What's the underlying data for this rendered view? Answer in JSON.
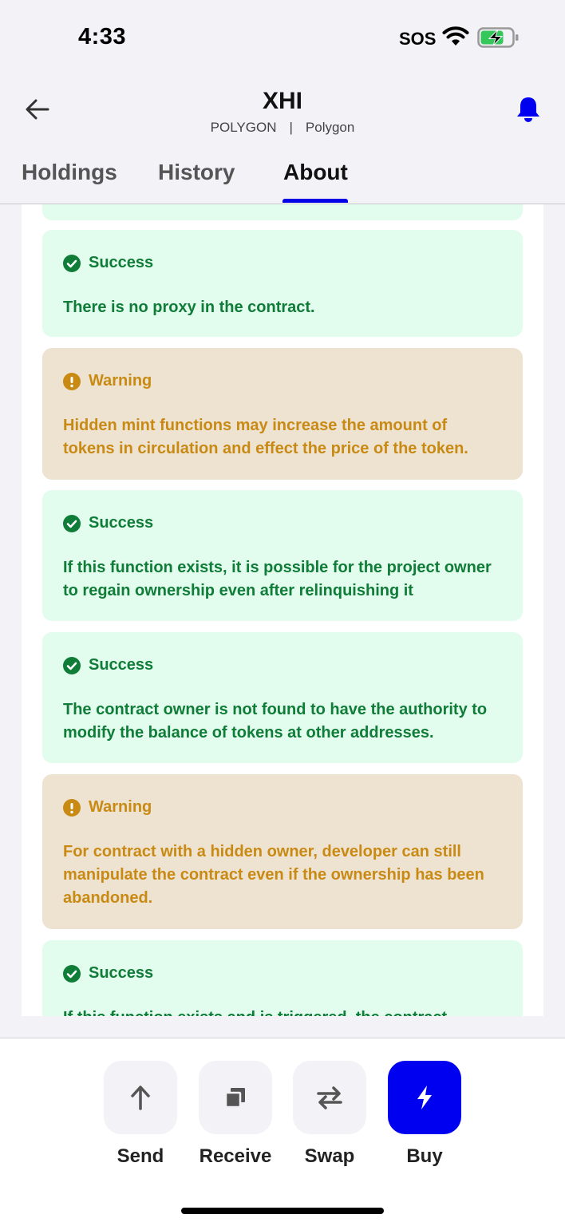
{
  "status": {
    "time": "4:33",
    "sos": "SOS"
  },
  "header": {
    "title": "XHI",
    "network": "POLYGON",
    "separator": "|",
    "chain": "Polygon"
  },
  "tabs": [
    {
      "label": "Holdings",
      "active": false
    },
    {
      "label": "History",
      "active": false
    },
    {
      "label": "About",
      "active": true
    }
  ],
  "checks": [
    {
      "status": "Success",
      "text": "There is no proxy in the contract."
    },
    {
      "status": "Warning",
      "text": "Hidden mint functions may increase the amount of tokens in circulation and effect the price of the token."
    },
    {
      "status": "Success",
      "text": "If this function exists, it is possible for the project owner to regain ownership even after relinquishing it"
    },
    {
      "status": "Success",
      "text": "The contract owner is not found to have the authority to modify the balance of tokens at other addresses."
    },
    {
      "status": "Warning",
      "text": "For contract with a hidden owner, developer can still manipulate the contract even if the ownership has been abandoned."
    },
    {
      "status": "Success",
      "text": "If this function exists and is triggered, the contract"
    }
  ],
  "actions": [
    {
      "label": "Send",
      "icon": "arrow-up-icon"
    },
    {
      "label": "Receive",
      "icon": "copy-icon"
    },
    {
      "label": "Swap",
      "icon": "swap-icon"
    },
    {
      "label": "Buy",
      "icon": "lightning-icon"
    }
  ],
  "colors": {
    "accent": "#0000f0",
    "success_bg": "#e2fcee",
    "success_text": "#0f7c37",
    "warning_bg": "#eee2d0",
    "warning_text": "#c98a14"
  }
}
